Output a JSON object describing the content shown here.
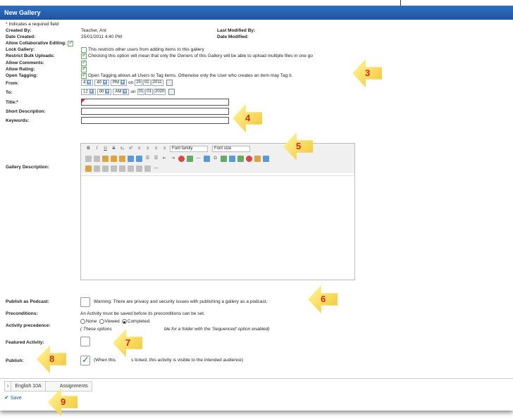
{
  "window": {
    "title": "New Gallery"
  },
  "required_note": "* Indicates a required field",
  "meta": {
    "created_by_label": "Created By:",
    "created_by": "Teacher, Ant",
    "date_created_label": "Date Created:",
    "date_created": "25/01/2011 4:40 PM",
    "last_modified_by_label": "Last Modified By:",
    "date_modified_label": "Date Modified:"
  },
  "options": {
    "collab_label": "Allow Collaborative Editing:",
    "lock_label": "Lock Gallery:",
    "lock_text": "This restricts other users from adding items to this gallery",
    "bulk_label": "Restrict Bulk Uploads:",
    "bulk_text": "Checking this option will mean that only the Owners of this Gallery will be able to upload multiple files in one go",
    "comments_label": "Allow Comments:",
    "rating_label": "Allow Rating:",
    "tagging_label": "Open Tagging:",
    "tagging_text": "Open Tagging allows all Users to Tag items. Otherwise only the User who creates an item may Tag it."
  },
  "from": {
    "label": "From:",
    "hour": "4",
    "minute": "40",
    "ampm": "PM",
    "on": "on",
    "day": "25",
    "month": "01",
    "year": "2011"
  },
  "to": {
    "label": "To:",
    "hour": "12",
    "minute": "00",
    "ampm": "AM",
    "on": "on",
    "day": "01",
    "month": "01",
    "year": "2020"
  },
  "fields": {
    "title_label": "Title:*",
    "short_desc_label": "Short Description:",
    "keywords_label": "Keywords:",
    "gallery_desc_label": "Gallery Description:"
  },
  "editor": {
    "font_family": "Font family",
    "font_size": "Font size"
  },
  "podcast": {
    "label": "Publish as Podcast:",
    "text": "Warning: There are privacy and security issues with publishing a gallery as a podcast."
  },
  "preconditions": {
    "label": "Preconditions:",
    "text": "An Activity must be saved before its preconditions can be set."
  },
  "precedence": {
    "label": "Activity precedence:",
    "opt_none": "None",
    "opt_viewed": "Viewed",
    "opt_completed": "Completed",
    "note_start": "( These options",
    "note_end": "ble for a folder with the 'Sequenced' option enabled)"
  },
  "featured": {
    "label": "Featured Activity:"
  },
  "publish": {
    "label": "Publish:",
    "text_start": "(When this",
    "text_end": "s ticked, this activity is visible to the intended audience)"
  },
  "breadcrumbs": [
    "English 10A",
    "Assignments"
  ],
  "save_label": "Save",
  "callouts": [
    "3",
    "4",
    "5",
    "6",
    "7",
    "8",
    "9"
  ]
}
